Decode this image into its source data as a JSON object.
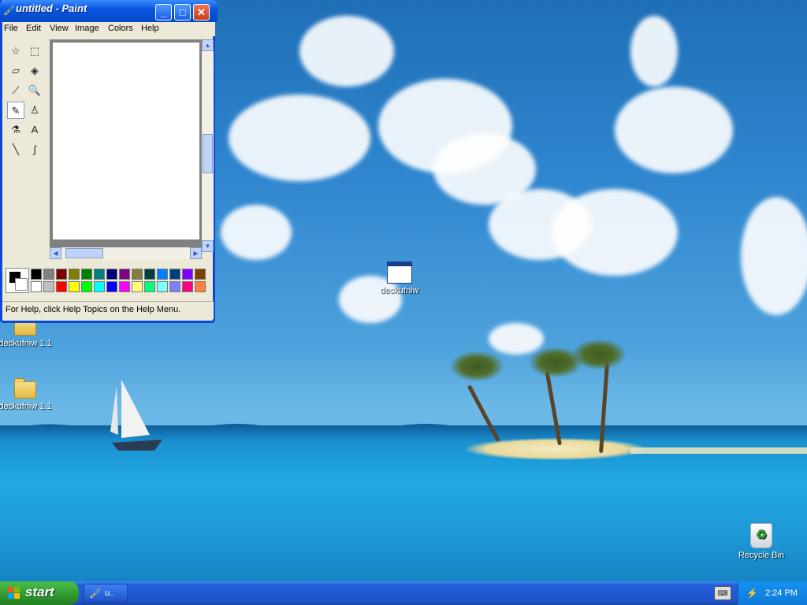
{
  "paint": {
    "title": "untitled - Paint",
    "menu": [
      "File",
      "Edit",
      "View",
      "Image",
      "Colors",
      "Help"
    ],
    "tools": [
      {
        "name": "free-form-select-icon",
        "glyph": "☆"
      },
      {
        "name": "select-icon",
        "glyph": "⬚"
      },
      {
        "name": "eraser-icon",
        "glyph": "▱"
      },
      {
        "name": "fill-bucket-icon",
        "glyph": "◈"
      },
      {
        "name": "pick-color-icon",
        "glyph": "⟋"
      },
      {
        "name": "magnifier-icon",
        "glyph": "🔍"
      },
      {
        "name": "pencil-icon",
        "glyph": "✎"
      },
      {
        "name": "brush-icon",
        "glyph": "♙"
      },
      {
        "name": "airbrush-icon",
        "glyph": "⚗"
      },
      {
        "name": "text-icon",
        "glyph": "A"
      },
      {
        "name": "line-icon",
        "glyph": "╲"
      },
      {
        "name": "curve-icon",
        "glyph": "∫"
      }
    ],
    "selected_tool": "pencil-icon",
    "palette_top": [
      "#000000",
      "#808080",
      "#800000",
      "#808000",
      "#008000",
      "#008080",
      "#000080",
      "#800080",
      "#808040",
      "#004040",
      "#0080ff",
      "#004080",
      "#8000ff",
      "#804000"
    ],
    "palette_bottom": [
      "#ffffff",
      "#c0c0c0",
      "#ff0000",
      "#ffff00",
      "#00ff00",
      "#00ffff",
      "#0000ff",
      "#ff00ff",
      "#ffff80",
      "#00ff80",
      "#80ffff",
      "#8080ff",
      "#ff0080",
      "#ff8040"
    ],
    "foreground_color": "#000000",
    "background_color": "#ffffff",
    "status_text": "For Help, click Help Topics on the Help Menu."
  },
  "desktop": {
    "icons": [
      {
        "id": "folder-1",
        "label": "deckufniw 1.1"
      },
      {
        "id": "folder-2",
        "label": "deckufniw 1.1"
      },
      {
        "id": "app-1",
        "label": "deckufniw"
      },
      {
        "id": "recycle-bin",
        "label": "Recycle Bin"
      }
    ]
  },
  "taskbar": {
    "start_label": "start",
    "tasks": [
      {
        "label": "u..",
        "icon": "paint-icon"
      }
    ],
    "clock": "2:24 PM"
  }
}
